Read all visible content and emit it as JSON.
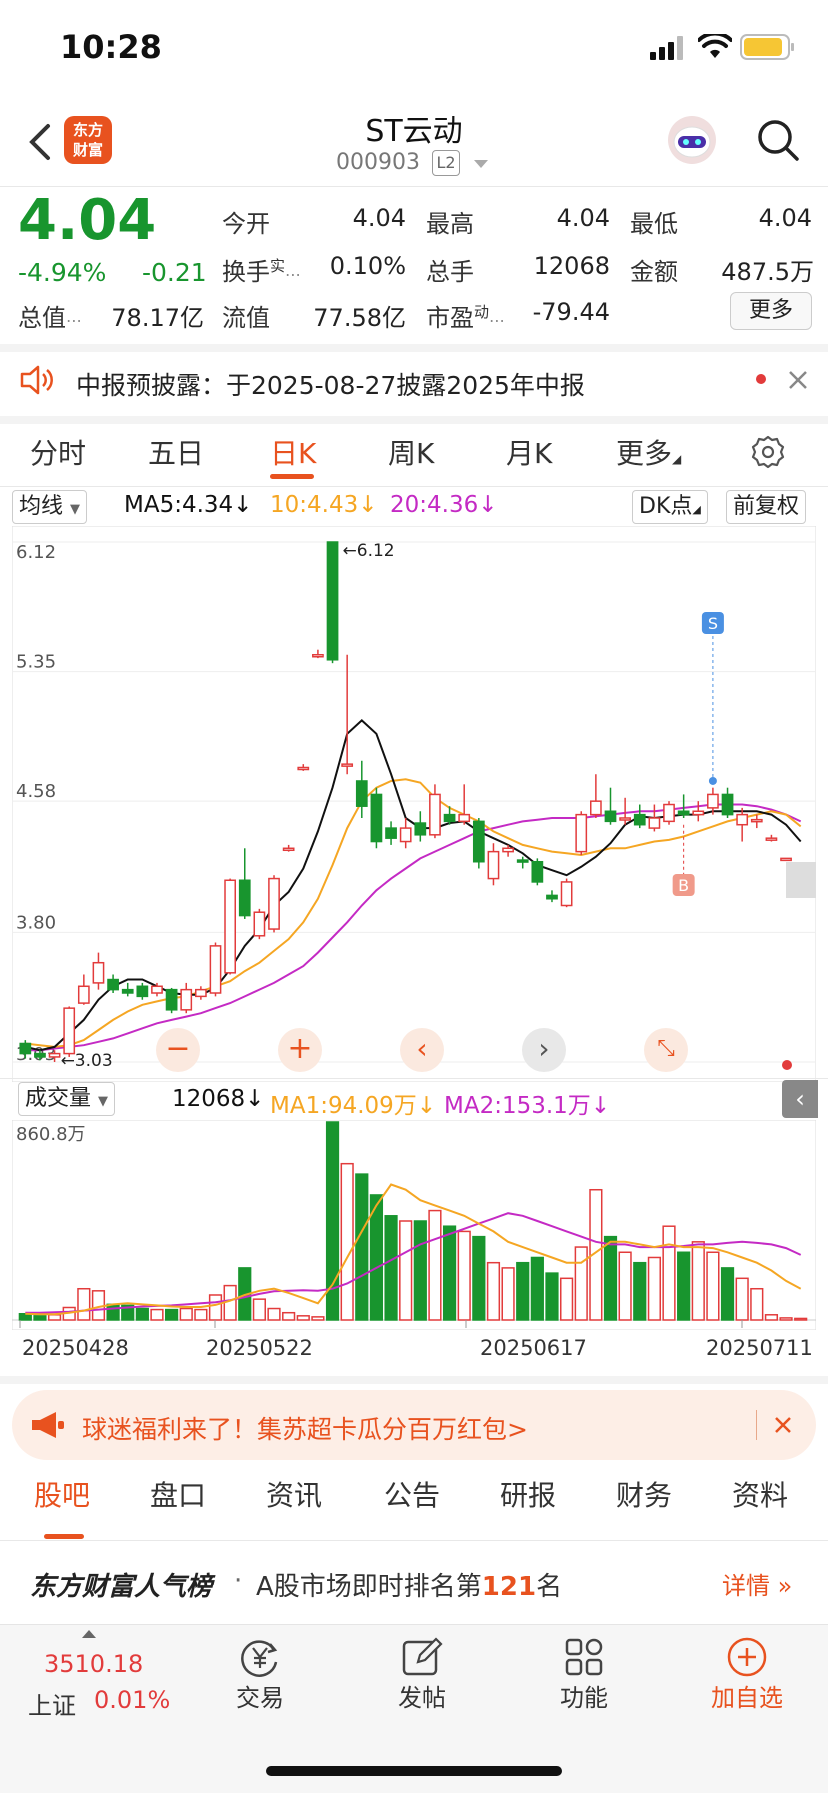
{
  "status": {
    "time": "10:28"
  },
  "header": {
    "logo_text": "东方财富",
    "name": "ST云动",
    "code": "000903",
    "level": "L2"
  },
  "quote": {
    "price": "4.04",
    "change_pct": "-4.94%",
    "change": "-0.21",
    "open_label": "今开",
    "open": "4.04",
    "high_label": "最高",
    "high": "4.04",
    "low_label": "最低",
    "low": "4.04",
    "turnover_label": "换手",
    "turnover_sup": "实",
    "turnover": "0.10%",
    "volume_label": "总手",
    "volume": "12068",
    "amount_label": "金额",
    "amount": "487.5万",
    "mktcap_label": "总值",
    "mktcap": "78.17亿",
    "float_label": "流值",
    "float": "77.58亿",
    "pe_label": "市盈",
    "pe_sup": "动",
    "pe": "-79.44",
    "more": "更多"
  },
  "notice": {
    "text": "中报预披露：于2025-08-27披露2025年中报"
  },
  "tabs": [
    "分时",
    "五日",
    "日K",
    "周K",
    "月K",
    "更多"
  ],
  "ma_row": {
    "selector": "均线",
    "ma5": "MA5:4.34",
    "ma10": "10:4.43",
    "ma20": "20:4.36",
    "dk": "DK点",
    "adj": "前复权"
  },
  "vol_row": {
    "selector": "成交量",
    "vol": "12068",
    "ma1": "MA1:94.09万",
    "ma2": "MA2:153.1万"
  },
  "chart_data": {
    "type": "candlestick",
    "y_ticks": [
      "6.12",
      "5.35",
      "4.58",
      "3.80",
      "3.03"
    ],
    "ylim": [
      3.03,
      6.12
    ],
    "max_label": "6.12",
    "min_label": "3.03",
    "vol_max_label": "860.8万",
    "dates": [
      "20250428",
      "20250522",
      "20250617",
      "20250711"
    ],
    "signals": {
      "sell": "S",
      "buy": "B"
    },
    "colors": {
      "up": "#e23b3b",
      "down": "#18952e",
      "ma5": "#111111",
      "ma10": "#f5a623",
      "ma20": "#c42ac4"
    },
    "candles": [
      [
        3.14,
        3.08,
        3.16,
        3.05
      ],
      [
        3.08,
        3.06,
        3.1,
        3.04
      ],
      [
        3.06,
        3.08,
        3.1,
        3.03
      ],
      [
        3.08,
        3.35,
        3.36,
        3.06
      ],
      [
        3.38,
        3.48,
        3.55,
        3.37
      ],
      [
        3.5,
        3.62,
        3.68,
        3.46
      ],
      [
        3.52,
        3.46,
        3.55,
        3.44
      ],
      [
        3.46,
        3.44,
        3.5,
        3.42
      ],
      [
        3.48,
        3.42,
        3.5,
        3.4
      ],
      [
        3.44,
        3.48,
        3.5,
        3.42
      ],
      [
        3.46,
        3.34,
        3.47,
        3.32
      ],
      [
        3.34,
        3.46,
        3.5,
        3.32
      ],
      [
        3.42,
        3.46,
        3.48,
        3.4
      ],
      [
        3.44,
        3.72,
        3.74,
        3.42
      ],
      [
        3.56,
        4.11,
        4.12,
        3.55
      ],
      [
        4.11,
        3.9,
        4.3,
        3.88
      ],
      [
        3.78,
        3.92,
        3.94,
        3.76
      ],
      [
        3.82,
        4.12,
        4.14,
        3.8
      ],
      [
        4.3,
        4.3,
        4.32,
        4.28
      ],
      [
        4.78,
        4.78,
        4.8,
        4.76
      ],
      [
        5.45,
        5.45,
        5.48,
        5.43
      ],
      [
        6.12,
        5.42,
        6.12,
        5.4
      ],
      [
        4.8,
        4.8,
        5.45,
        4.74
      ],
      [
        4.7,
        4.55,
        4.82,
        4.48
      ],
      [
        4.62,
        4.34,
        4.66,
        4.3
      ],
      [
        4.42,
        4.36,
        4.46,
        4.32
      ],
      [
        4.34,
        4.42,
        4.48,
        4.3
      ],
      [
        4.45,
        4.38,
        4.52,
        4.34
      ],
      [
        4.38,
        4.62,
        4.68,
        4.36
      ],
      [
        4.5,
        4.46,
        4.55,
        4.44
      ],
      [
        4.46,
        4.5,
        4.68,
        4.44
      ],
      [
        4.46,
        4.22,
        4.48,
        4.18
      ],
      [
        4.12,
        4.28,
        4.33,
        4.08
      ],
      [
        4.28,
        4.3,
        4.32,
        4.25
      ],
      [
        4.23,
        4.22,
        4.25,
        4.18
      ],
      [
        4.22,
        4.1,
        4.24,
        4.08
      ],
      [
        4.02,
        4.0,
        4.05,
        3.98
      ],
      [
        3.96,
        4.1,
        4.12,
        3.95
      ],
      [
        4.28,
        4.5,
        4.52,
        4.26
      ],
      [
        4.5,
        4.58,
        4.74,
        4.48
      ],
      [
        4.52,
        4.46,
        4.66,
        4.44
      ],
      [
        4.48,
        4.48,
        4.6,
        4.44
      ],
      [
        4.5,
        4.44,
        4.56,
        4.42
      ],
      [
        4.42,
        4.48,
        4.56,
        4.4
      ],
      [
        4.46,
        4.56,
        4.58,
        4.44
      ],
      [
        4.52,
        4.5,
        4.62,
        4.48
      ],
      [
        4.5,
        4.52,
        4.58,
        4.46
      ],
      [
        4.54,
        4.62,
        4.66,
        4.5
      ],
      [
        4.62,
        4.5,
        4.66,
        4.48
      ],
      [
        4.44,
        4.5,
        4.54,
        4.34
      ],
      [
        4.47,
        4.47,
        4.5,
        4.42
      ],
      [
        4.36,
        4.36,
        4.38,
        4.34
      ],
      [
        4.24,
        4.24,
        4.24,
        4.24
      ],
      [
        4.04,
        4.04,
        4.04,
        4.04
      ]
    ],
    "volumes": [
      12,
      8,
      10,
      24,
      60,
      56,
      30,
      28,
      22,
      20,
      20,
      22,
      20,
      48,
      66,
      100,
      40,
      22,
      14,
      8,
      6,
      380,
      300,
      280,
      240,
      200,
      190,
      190,
      210,
      180,
      170,
      160,
      110,
      100,
      110,
      120,
      90,
      80,
      140,
      250,
      160,
      130,
      110,
      120,
      180,
      130,
      150,
      130,
      100,
      80,
      60,
      10,
      4,
      3
    ],
    "ma5_line": [
      3.12,
      3.1,
      3.12,
      3.2,
      3.28,
      3.4,
      3.48,
      3.52,
      3.52,
      3.48,
      3.44,
      3.43,
      3.43,
      3.47,
      3.58,
      3.72,
      3.82,
      3.96,
      4.04,
      4.18,
      4.4,
      4.66,
      4.98,
      5.06,
      4.98,
      4.74,
      4.48,
      4.42,
      4.42,
      4.45,
      4.46,
      4.4,
      4.36,
      4.32,
      4.27,
      4.2,
      4.17,
      4.14,
      4.19,
      4.25,
      4.33,
      4.44,
      4.49,
      4.48,
      4.49,
      4.5,
      4.5,
      4.52,
      4.52,
      4.52,
      4.52,
      4.5,
      4.44,
      4.34
    ],
    "ma10_line": [
      3.14,
      3.13,
      3.12,
      3.13,
      3.16,
      3.22,
      3.28,
      3.33,
      3.37,
      3.39,
      3.41,
      3.42,
      3.45,
      3.48,
      3.51,
      3.57,
      3.62,
      3.69,
      3.76,
      3.86,
      4.0,
      4.2,
      4.42,
      4.58,
      4.66,
      4.7,
      4.71,
      4.69,
      4.6,
      4.54,
      4.5,
      4.46,
      4.4,
      4.36,
      4.32,
      4.3,
      4.28,
      4.27,
      4.26,
      4.28,
      4.3,
      4.3,
      4.32,
      4.34,
      4.35,
      4.37,
      4.4,
      4.43,
      4.46,
      4.48,
      4.5,
      4.52,
      4.5,
      4.43
    ],
    "ma20_line": [
      3.1,
      3.1,
      3.11,
      3.12,
      3.13,
      3.15,
      3.17,
      3.2,
      3.23,
      3.26,
      3.28,
      3.3,
      3.32,
      3.35,
      3.38,
      3.42,
      3.46,
      3.5,
      3.55,
      3.6,
      3.68,
      3.77,
      3.86,
      3.96,
      4.05,
      4.12,
      4.18,
      4.24,
      4.28,
      4.32,
      4.36,
      4.4,
      4.42,
      4.44,
      4.46,
      4.47,
      4.48,
      4.48,
      4.48,
      4.49,
      4.5,
      4.51,
      4.52,
      4.52,
      4.53,
      4.54,
      4.55,
      4.56,
      4.56,
      4.56,
      4.55,
      4.53,
      4.5,
      4.46
    ],
    "vol_ma1": [
      12,
      11,
      11,
      14,
      18,
      25,
      30,
      32,
      30,
      28,
      26,
      25,
      25,
      29,
      37,
      48,
      56,
      60,
      52,
      42,
      32,
      68,
      120,
      170,
      220,
      260,
      250,
      230,
      220,
      210,
      200,
      185,
      170,
      150,
      140,
      130,
      120,
      110,
      110,
      130,
      150,
      150,
      145,
      140,
      145,
      140,
      140,
      138,
      130,
      120,
      110,
      95,
      75,
      60
    ],
    "vol_ma2": [
      14,
      14,
      15,
      16,
      18,
      20,
      22,
      24,
      26,
      27,
      28,
      30,
      32,
      34,
      38,
      44,
      50,
      55,
      56,
      57,
      56,
      60,
      70,
      85,
      100,
      115,
      130,
      145,
      155,
      165,
      175,
      185,
      195,
      205,
      200,
      190,
      180,
      170,
      160,
      150,
      145,
      145,
      140,
      140,
      140,
      142,
      145,
      145,
      148,
      150,
      148,
      145,
      138,
      125
    ]
  },
  "promo": {
    "text": "球迷福利来了！集苏超卡瓜分百万红包>"
  },
  "sub_tabs": [
    "股吧",
    "盘口",
    "资讯",
    "公告",
    "研报",
    "财务",
    "资料"
  ],
  "rank": {
    "brand": "东方财富人气榜",
    "sep": "·",
    "prefix": "A股市场即时排名第",
    "rank": "121",
    "suffix": "名",
    "detail": "详情"
  },
  "bottom_bar": {
    "index_value": "3510.18",
    "index_name": "上证",
    "index_change": "0.01%",
    "items": [
      "交易",
      "发帖",
      "功能",
      "加自选"
    ]
  }
}
